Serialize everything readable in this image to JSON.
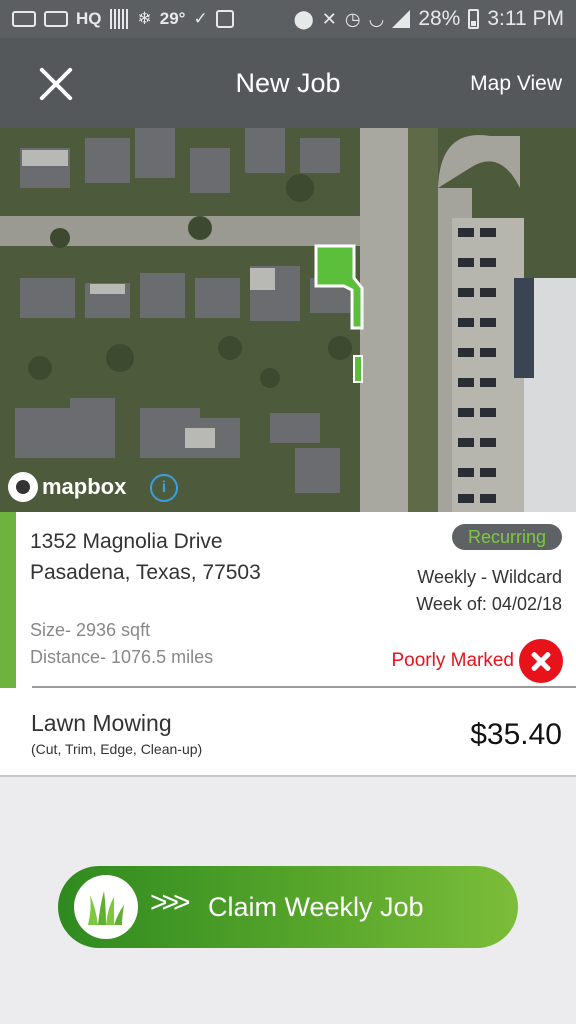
{
  "status_bar": {
    "left_text": "HQ",
    "temperature": "29°",
    "battery": "28%",
    "time": "3:11 PM",
    "icons": [
      "message-icon",
      "voicemail-icon",
      "hq-icon",
      "grid-icon",
      "snowflake-icon",
      "check-icon",
      "image-icon",
      "location-icon",
      "mute-icon",
      "alarm-icon",
      "wifi-icon",
      "signal-icon",
      "battery-icon"
    ]
  },
  "app_bar": {
    "title": "New Job",
    "right_action": "Map View",
    "close_icon": "close-icon"
  },
  "map": {
    "attribution": "mapbox",
    "info_icon": "info-icon",
    "highlight_color": "#5bbf3c"
  },
  "job": {
    "address_line1": "1352 Magnolia Drive",
    "address_line2": "Pasadena, Texas, 77503",
    "size": "Size- 2936 sqft",
    "distance": "Distance- 1076.5 miles",
    "badge": "Recurring",
    "frequency": "Weekly - Wildcard",
    "week_of": "Week of: 04/02/18",
    "marking_status": "Poorly Marked",
    "accent_color": "#6cb33f",
    "alert_color": "#e8121a"
  },
  "service": {
    "name": "Lawn Mowing",
    "description": "(Cut, Trim, Edge, Clean-up)",
    "price": "$35.40"
  },
  "claim": {
    "chevrons": ">>>",
    "label": "Claim Weekly Job",
    "icon": "grass-icon"
  }
}
